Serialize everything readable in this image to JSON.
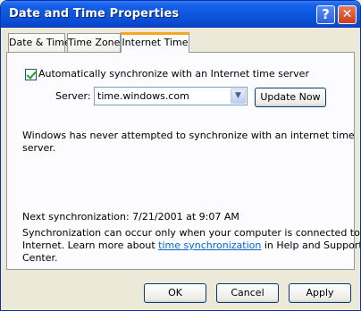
{
  "window": {
    "title": "Date and Time Properties",
    "help_label": "?",
    "close_label": "✕"
  },
  "tabs": [
    {
      "label": "Date & Time"
    },
    {
      "label": "Time Zone"
    },
    {
      "label": "Internet Time",
      "active": true
    }
  ],
  "internet_time": {
    "auto_sync_label": "Automatically synchronize with an Internet time server",
    "auto_sync_checked": true,
    "server_label": "Server:",
    "server_value": "time.windows.com",
    "update_now_label": "Update Now",
    "status_line1": "Windows has never attempted to synchronize with an internet time",
    "status_line2": "server.",
    "next_sync": "Next synchronization: 7/21/2001 at 9:07 AM",
    "note_line1": "Synchronization can occur only when your computer is connected to the",
    "note_line2_prefix": "Internet.  Learn more about ",
    "note_link": "time synchronization",
    "note_line2_suffix": " in Help and Support",
    "note_line3": "Center."
  },
  "footer": {
    "ok_label": "OK",
    "cancel_label": "Cancel",
    "apply_label": "Apply"
  }
}
